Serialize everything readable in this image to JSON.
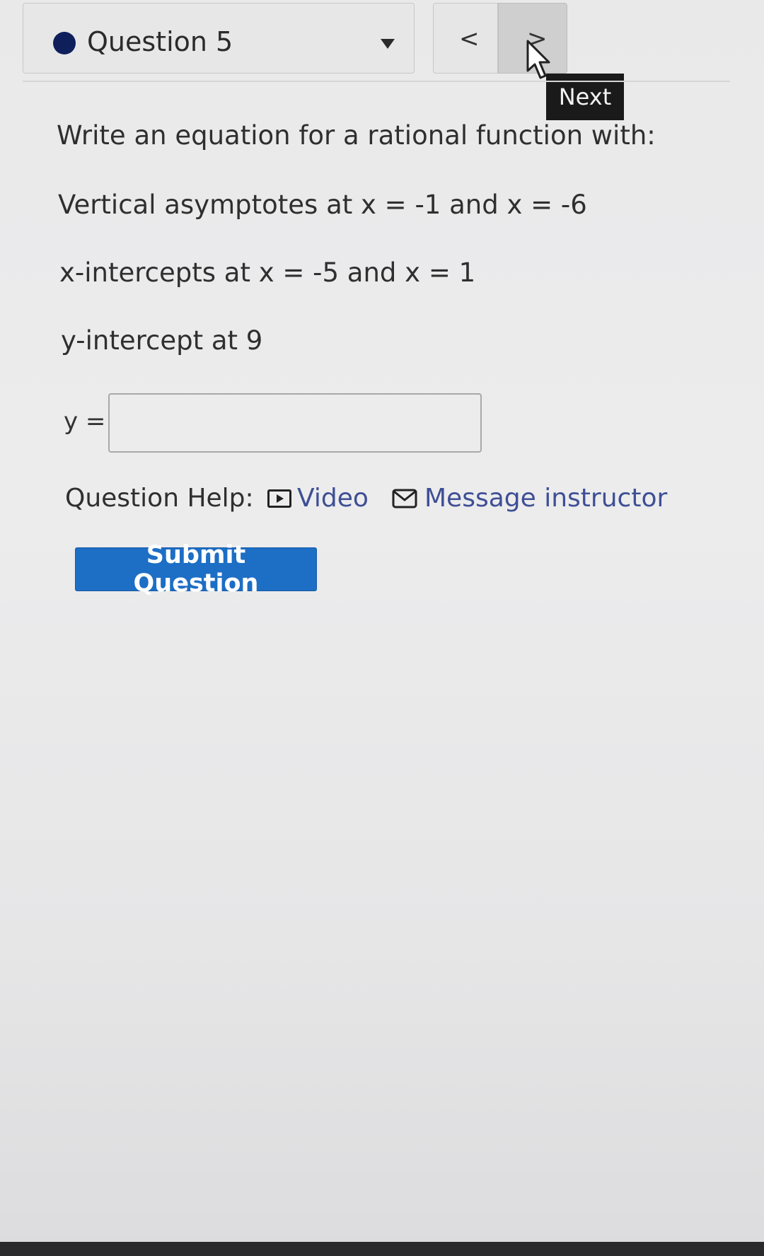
{
  "header": {
    "question_label": "Question 5",
    "prev_icon": "<",
    "next_icon": ">",
    "tooltip": "Next",
    "status_color": "#0f1f5c"
  },
  "question": {
    "prompt": "Write an equation for a rational function with:",
    "conditions": [
      "Vertical asymptotes at x = -1 and x = -6",
      "x-intercepts at x = -5 and x = 1",
      "y-intercept at 9"
    ],
    "answer_label": "y =",
    "answer_value": ""
  },
  "help": {
    "label": "Question Help:",
    "video_label": "Video",
    "message_label": "Message instructor",
    "link_color": "#3e4f95"
  },
  "actions": {
    "submit_label": "Submit Question",
    "submit_color": "#1d6ec5"
  }
}
